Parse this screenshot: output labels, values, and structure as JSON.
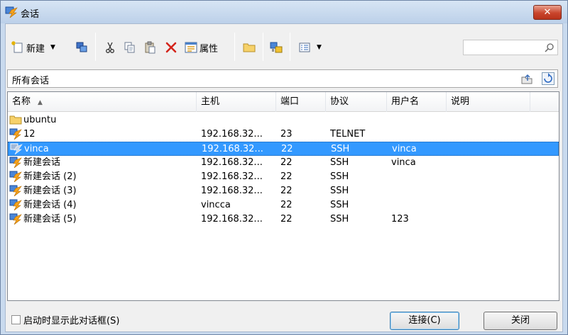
{
  "window": {
    "title": "会话",
    "close_glyph": "✕"
  },
  "toolbar": {
    "new_label": "新建",
    "properties_label": "属性",
    "icons": [
      "new-session-icon",
      "connect-icon",
      "cut-icon",
      "copy-icon",
      "paste-icon",
      "delete-icon",
      "properties-icon",
      "folder-icon",
      "session-group-icon",
      "view-icon"
    ],
    "search_placeholder": ""
  },
  "path": {
    "text": "所有会话"
  },
  "columns": [
    {
      "key": "name",
      "label": "名称"
    },
    {
      "key": "host",
      "label": "主机"
    },
    {
      "key": "port",
      "label": "端口"
    },
    {
      "key": "protocol",
      "label": "协议"
    },
    {
      "key": "user",
      "label": "用户名"
    },
    {
      "key": "desc",
      "label": "说明"
    }
  ],
  "sessions": [
    {
      "type": "folder",
      "name": "ubuntu",
      "host": "",
      "port": "",
      "protocol": "",
      "user": "",
      "desc": ""
    },
    {
      "type": "session",
      "name": "12",
      "host": "192.168.32...",
      "port": "23",
      "protocol": "TELNET",
      "user": "",
      "desc": ""
    },
    {
      "type": "session",
      "name": "vinca",
      "host": "192.168.32...",
      "port": "22",
      "protocol": "SSH",
      "user": "vinca",
      "desc": "",
      "selected": true
    },
    {
      "type": "session",
      "name": "新建会话",
      "host": "192.168.32...",
      "port": "22",
      "protocol": "SSH",
      "user": "vinca",
      "desc": ""
    },
    {
      "type": "session",
      "name": "新建会话 (2)",
      "host": "192.168.32...",
      "port": "22",
      "protocol": "SSH",
      "user": "",
      "desc": ""
    },
    {
      "type": "session",
      "name": "新建会话 (3)",
      "host": "192.168.32...",
      "port": "22",
      "protocol": "SSH",
      "user": "",
      "desc": ""
    },
    {
      "type": "session",
      "name": "新建会话 (4)",
      "host": "vincca",
      "port": "22",
      "protocol": "SSH",
      "user": "",
      "desc": ""
    },
    {
      "type": "session",
      "name": "新建会话 (5)",
      "host": "192.168.32...",
      "port": "22",
      "protocol": "SSH",
      "user": "123",
      "desc": ""
    }
  ],
  "footer": {
    "startup_checkbox_label": "启动时显示此对话框(S)",
    "startup_checked": false,
    "connect_label": "连接(C)",
    "close_label": "关闭"
  },
  "colors": {
    "selection": "#3399ff",
    "title_gradient_top": "#d7e5f4",
    "close_red": "#c9452c"
  }
}
